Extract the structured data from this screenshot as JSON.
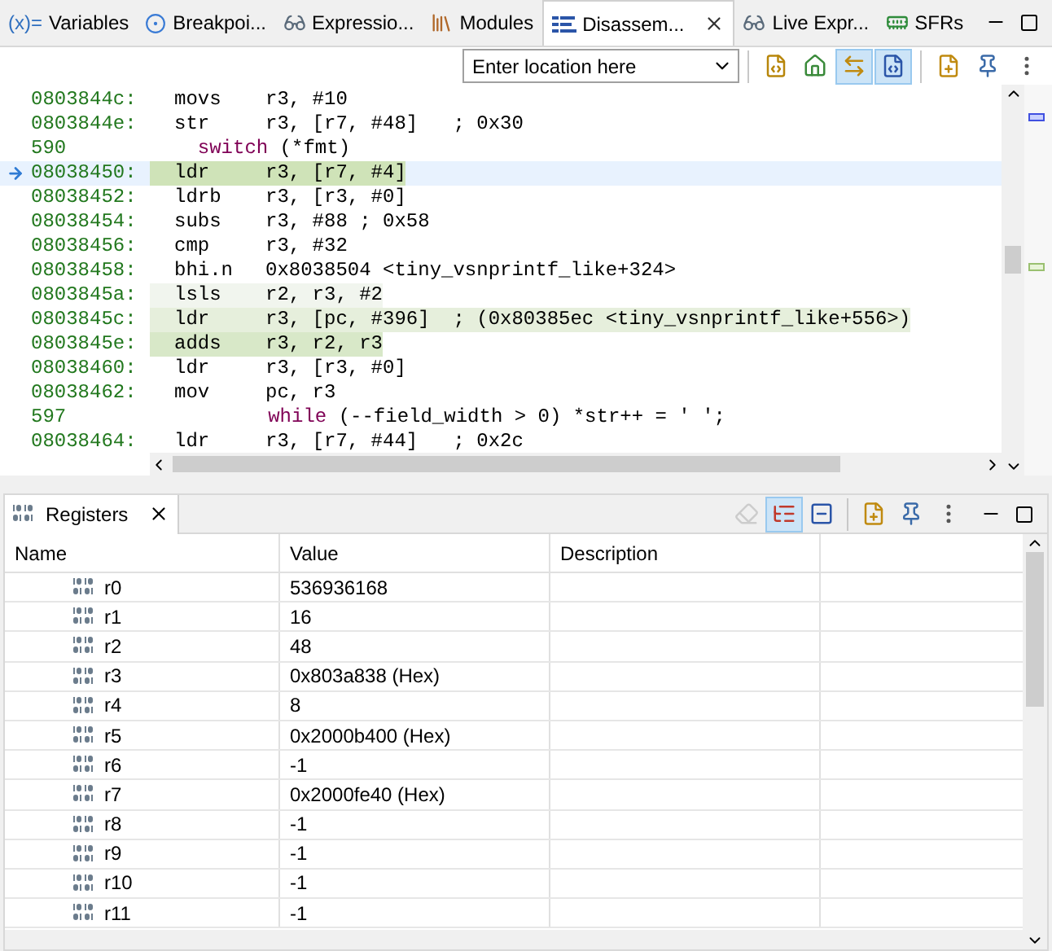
{
  "top_tabs": [
    {
      "label": "Variables",
      "kind": "vars",
      "icon_text": "(x)=",
      "selected": false
    },
    {
      "label": "Breakpoi...",
      "kind": "breakpoints",
      "selected": false
    },
    {
      "label": "Expressio...",
      "kind": "glasses",
      "selected": false
    },
    {
      "label": "Modules",
      "kind": "books",
      "selected": false
    },
    {
      "label": "Disassem...",
      "kind": "disasm",
      "selected": true
    },
    {
      "label": "Live Expr...",
      "kind": "glasses",
      "selected": false
    },
    {
      "label": "SFRs",
      "kind": "chip",
      "selected": false
    }
  ],
  "location": {
    "placeholder": "Enter location here"
  },
  "disasm_toolbar": [
    {
      "kind": "sync",
      "selected": false
    },
    {
      "kind": "home",
      "selected": false
    },
    {
      "kind": "link",
      "selected": true
    },
    {
      "kind": "source",
      "selected": true
    },
    {
      "kind": "sep"
    },
    {
      "kind": "newview",
      "selected": false
    },
    {
      "kind": "pin",
      "selected": false
    },
    {
      "kind": "more",
      "selected": false
    }
  ],
  "disassembly": [
    {
      "kind": "instr",
      "address": "0803844c:",
      "mnemonic": "movs",
      "operands": "r3, #10",
      "current": false,
      "highlighted": false
    },
    {
      "kind": "instr",
      "address": "0803844e:",
      "mnemonic": "str",
      "operands": "r3, [r7, #48]   ; 0x30",
      "current": false,
      "highlighted": false
    },
    {
      "kind": "source",
      "line": "590",
      "keyword": "  switch",
      "code": " (*fmt)"
    },
    {
      "kind": "instr",
      "address": "08038450:",
      "mnemonic": "ldr",
      "operands": "r3, [r7, #4]",
      "current": true,
      "highlighted": true,
      "color": "#cfe3b8"
    },
    {
      "kind": "instr",
      "address": "08038452:",
      "mnemonic": "ldrb",
      "operands": "r3, [r3, #0]",
      "current": false,
      "highlighted": false
    },
    {
      "kind": "instr",
      "address": "08038454:",
      "mnemonic": "subs",
      "operands": "r3, #88 ; 0x58",
      "current": false,
      "highlighted": false
    },
    {
      "kind": "instr",
      "address": "08038456:",
      "mnemonic": "cmp",
      "operands": "r3, #32",
      "current": false,
      "highlighted": false
    },
    {
      "kind": "instr",
      "address": "08038458:",
      "mnemonic": "bhi.n",
      "operands": "0x8038504 <tiny_vsnprintf_like+324>",
      "current": false,
      "highlighted": false
    },
    {
      "kind": "instr",
      "address": "0803845a:",
      "mnemonic": "lsls",
      "operands": "r2, r3, #2",
      "current": false,
      "highlighted": true,
      "color": "#f1f5ee"
    },
    {
      "kind": "instr",
      "address": "0803845c:",
      "mnemonic": "ldr",
      "operands": "r3, [pc, #396]  ; (0x80385ec <tiny_vsnprintf_like+556>)",
      "current": false,
      "highlighted": true,
      "color": "#e6efdc"
    },
    {
      "kind": "instr",
      "address": "0803845e:",
      "mnemonic": "adds",
      "operands": "r3, r2, r3",
      "current": false,
      "highlighted": true,
      "color": "#d8e8c8"
    },
    {
      "kind": "instr",
      "address": "08038460:",
      "mnemonic": "ldr",
      "operands": "r3, [r3, #0]",
      "current": false,
      "highlighted": false
    },
    {
      "kind": "instr",
      "address": "08038462:",
      "mnemonic": "mov",
      "operands": "pc, r3",
      "current": false,
      "highlighted": false
    },
    {
      "kind": "source",
      "line": "597",
      "keyword": "        while",
      "code": " (--field_width > 0) *str++ = ' ';"
    },
    {
      "kind": "instr",
      "address": "08038464:",
      "mnemonic": "ldr",
      "operands": "r3, [r7, #44]   ; 0x2c",
      "current": false,
      "highlighted": false
    }
  ],
  "registers_view": {
    "tab": {
      "label": "Registers",
      "selected": true
    },
    "toolbar": [
      {
        "kind": "clear",
        "selected": false,
        "disabled": true
      },
      {
        "kind": "layout",
        "selected": true,
        "disabled": false
      },
      {
        "kind": "collapse",
        "selected": false,
        "disabled": false
      },
      {
        "kind": "sep"
      },
      {
        "kind": "newview",
        "selected": false,
        "disabled": false
      },
      {
        "kind": "pin",
        "selected": false,
        "disabled": false
      },
      {
        "kind": "more",
        "selected": false,
        "disabled": false
      }
    ],
    "columns": [
      "Name",
      "Value",
      "Description"
    ],
    "rows": [
      {
        "name": "r0",
        "value": "536936168"
      },
      {
        "name": "r1",
        "value": "16"
      },
      {
        "name": "r2",
        "value": "48"
      },
      {
        "name": "r3",
        "value": "0x803a838 (Hex)"
      },
      {
        "name": "r4",
        "value": "8"
      },
      {
        "name": "r5",
        "value": "0x2000b400 (Hex)"
      },
      {
        "name": "r6",
        "value": "-1"
      },
      {
        "name": "r7",
        "value": "0x2000fe40 (Hex)"
      },
      {
        "name": "r8",
        "value": "-1"
      },
      {
        "name": "r9",
        "value": "-1"
      },
      {
        "name": "r10",
        "value": "-1"
      },
      {
        "name": "r11",
        "value": "-1"
      }
    ]
  }
}
